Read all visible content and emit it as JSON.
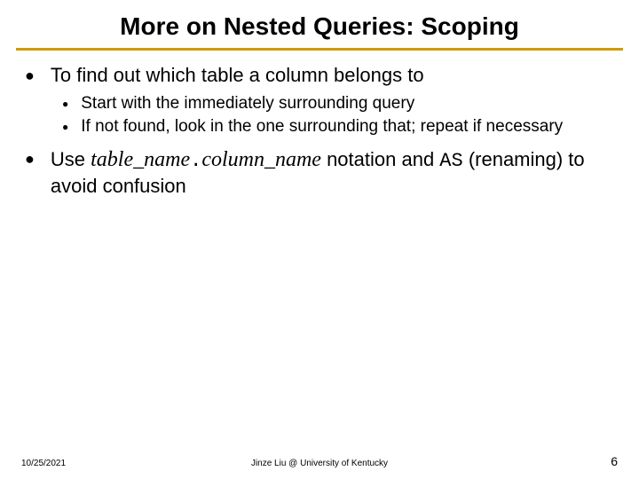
{
  "title": "More on Nested Queries: Scoping",
  "bullets": [
    {
      "text": "To find out which table a column belongs to",
      "sub": [
        "Start with the immediately surrounding query",
        "If not found, look in the one surrounding that; repeat if necessary"
      ]
    }
  ],
  "bullet2": {
    "prefix": "Use ",
    "italic1": "table_name",
    "dot": ".",
    "italic2": "column_name",
    "mid": " notation and ",
    "mono": "AS",
    "suffix": " (renaming) to avoid confusion"
  },
  "footer": {
    "date": "10/25/2021",
    "center": "Jinze Liu @ University of Kentucky",
    "page": "6"
  }
}
